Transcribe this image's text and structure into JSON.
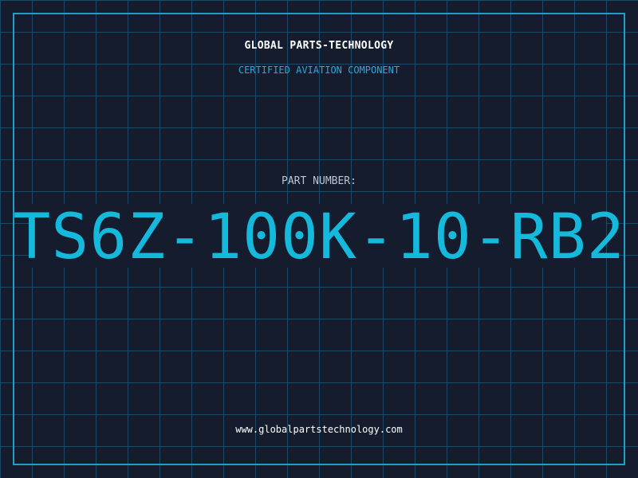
{
  "brand": {
    "name": "GLOBAL PARTS-TECHNOLOGY",
    "subtitle": "CERTIFIED AVIATION COMPONENT"
  },
  "part": {
    "label": "PART NUMBER:",
    "number": "TS6Z-100K-10-RB2"
  },
  "footer": {
    "website": "www.globalpartstechnology.com"
  },
  "colors": {
    "background": "#141c2e",
    "grid": "#1e5a78",
    "accent": "#15b9dc",
    "frame": "#1f9fc4",
    "text": "#ffffff"
  }
}
